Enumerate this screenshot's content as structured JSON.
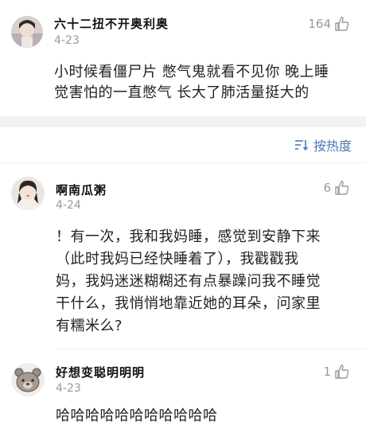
{
  "comments": [
    {
      "name": "六十二扭不开奥利奥",
      "date": "4-23",
      "likes": "164",
      "text_lines": [
        "小时候看僵尸片 憋气鬼就看不见你 晚上睡",
        "觉害怕的一直憋气 长大了肺活量挺大的"
      ]
    },
    {
      "name": "啊南瓜粥",
      "date": "4-24",
      "likes": "6",
      "text_lines": [
        "！有一次，我和我妈睡，感觉到安静下来",
        "（此时我妈已经快睡着了），我戳戳我",
        "妈，我妈迷迷糊糊还有点暴躁问我不睡觉",
        "干什么，我悄悄地靠近她的耳朵，问家里",
        "有糯米么?"
      ]
    },
    {
      "name": "好想变聪明明明",
      "date": "4-23",
      "likes": "1",
      "text_lines": [
        "哈哈哈哈哈哈哈哈哈哈哈"
      ]
    }
  ],
  "sort": {
    "label": "按热度",
    "icon": "sort-icon"
  },
  "icons": {
    "like": "thumbs-up-icon"
  },
  "colors": {
    "accent": "#4a78b8",
    "muted": "#9a9a9a",
    "divider": "#f2f2f2"
  }
}
